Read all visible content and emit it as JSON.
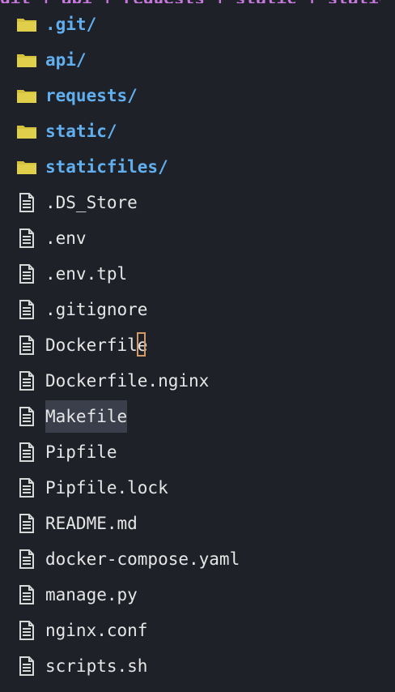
{
  "tree": {
    "top_clipped_text": "git + api + requests + static + staticfiles + scripts",
    "items": [
      {
        "type": "folder",
        "label": ".git/",
        "icon": "folder-icon"
      },
      {
        "type": "folder",
        "label": "api/",
        "icon": "folder-icon"
      },
      {
        "type": "folder",
        "label": "requests/",
        "icon": "folder-icon"
      },
      {
        "type": "folder",
        "label": "static/",
        "icon": "folder-icon"
      },
      {
        "type": "folder",
        "label": "staticfiles/",
        "icon": "folder-icon"
      },
      {
        "type": "file",
        "label": ".DS_Store",
        "icon": "file-icon"
      },
      {
        "type": "file",
        "label": ".env",
        "icon": "file-icon"
      },
      {
        "type": "file",
        "label": ".env.tpl",
        "icon": "file-icon"
      },
      {
        "type": "file",
        "label": ".gitignore",
        "icon": "file-icon"
      },
      {
        "type": "file",
        "label": "Dockerfile",
        "icon": "file-icon",
        "cursor": true
      },
      {
        "type": "file",
        "label": "Dockerfile.nginx",
        "icon": "file-icon"
      },
      {
        "type": "file",
        "label": "Makefile",
        "icon": "file-icon",
        "selected": true
      },
      {
        "type": "file",
        "label": "Pipfile",
        "icon": "file-icon"
      },
      {
        "type": "file",
        "label": "Pipfile.lock",
        "icon": "file-icon"
      },
      {
        "type": "file",
        "label": "README.md",
        "icon": "file-icon"
      },
      {
        "type": "file",
        "label": "docker-compose.yaml",
        "icon": "file-icon"
      },
      {
        "type": "file",
        "label": "manage.py",
        "icon": "file-icon"
      },
      {
        "type": "file",
        "label": "nginx.conf",
        "icon": "file-icon"
      },
      {
        "type": "file",
        "label": "scripts.sh",
        "icon": "file-icon"
      }
    ]
  },
  "colors": {
    "background": "#1e2128",
    "folder_icon": "#d6c23a",
    "folder_text": "#61afef",
    "file_text": "#e6e6e6",
    "file_icon": "#d8d8d8",
    "selection": "#3a3f4b",
    "cursor": "#d19a66"
  }
}
